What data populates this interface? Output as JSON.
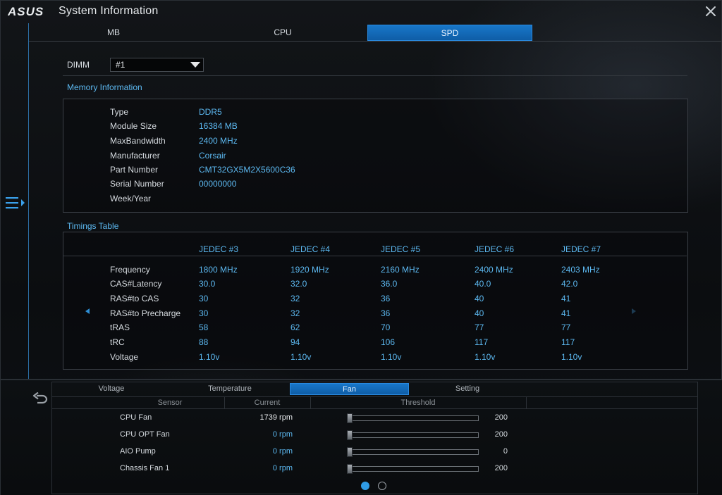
{
  "app": {
    "brand": "ASUS",
    "title": "System Information"
  },
  "top_tabs": [
    {
      "label": "MB",
      "active": false
    },
    {
      "label": "CPU",
      "active": false
    },
    {
      "label": "SPD",
      "active": true
    }
  ],
  "dimm": {
    "label": "DIMM",
    "value": "#1"
  },
  "memory_info": {
    "title": "Memory Information",
    "rows": [
      {
        "label": "Type",
        "value": "DDR5"
      },
      {
        "label": "Module Size",
        "value": "16384 MB"
      },
      {
        "label": "MaxBandwidth",
        "value": "2400 MHz"
      },
      {
        "label": "Manufacturer",
        "value": "Corsair"
      },
      {
        "label": "Part Number",
        "value": "CMT32GX5M2X5600C36"
      },
      {
        "label": "Serial Number",
        "value": "00000000"
      },
      {
        "label": "Week/Year",
        "value": ""
      }
    ]
  },
  "timings": {
    "title": "Timings Table",
    "columns": [
      "JEDEC #3",
      "JEDEC #4",
      "JEDEC #5",
      "JEDEC #6",
      "JEDEC #7"
    ],
    "rows": [
      {
        "label": "Frequency",
        "values": [
          "1800 MHz",
          "1920 MHz",
          "2160 MHz",
          "2400 MHz",
          "2403 MHz"
        ]
      },
      {
        "label": "CAS#Latency",
        "values": [
          "30.0",
          "32.0",
          "36.0",
          "40.0",
          "42.0"
        ]
      },
      {
        "label": "RAS#to CAS",
        "values": [
          "30",
          "32",
          "36",
          "40",
          "41"
        ]
      },
      {
        "label": "RAS#to Precharge",
        "values": [
          "30",
          "32",
          "36",
          "40",
          "41"
        ]
      },
      {
        "label": "tRAS",
        "values": [
          "58",
          "62",
          "70",
          "77",
          "77"
        ]
      },
      {
        "label": "tRC",
        "values": [
          "88",
          "94",
          "106",
          "117",
          "117"
        ]
      },
      {
        "label": "Voltage",
        "values": [
          "1.10v",
          "1.10v",
          "1.10v",
          "1.10v",
          "1.10v"
        ]
      }
    ]
  },
  "bottom_tabs": [
    {
      "label": "Voltage",
      "active": false
    },
    {
      "label": "Temperature",
      "active": false
    },
    {
      "label": "Fan",
      "active": true
    },
    {
      "label": "Setting",
      "active": false
    }
  ],
  "fan_table": {
    "headers": {
      "sensor": "Sensor",
      "current": "Current",
      "threshold": "Threshold"
    },
    "rows": [
      {
        "name": "CPU Fan",
        "current": "1739 rpm",
        "threshold": "200",
        "threshold_level": 0.0
      },
      {
        "name": "CPU OPT Fan",
        "current": "0 rpm",
        "threshold": "200",
        "threshold_level": 0.0
      },
      {
        "name": "AIO Pump",
        "current": "0 rpm",
        "threshold": "0",
        "threshold_level": 0.0
      },
      {
        "name": "Chassis Fan 1",
        "current": "0 rpm",
        "threshold": "200",
        "threshold_level": 0.0
      }
    ]
  },
  "pagination": {
    "pages": 2,
    "current": 1
  },
  "colors": {
    "accent": "#1877c9",
    "value_text": "#5cb8f0",
    "border": "#3a3f46"
  }
}
